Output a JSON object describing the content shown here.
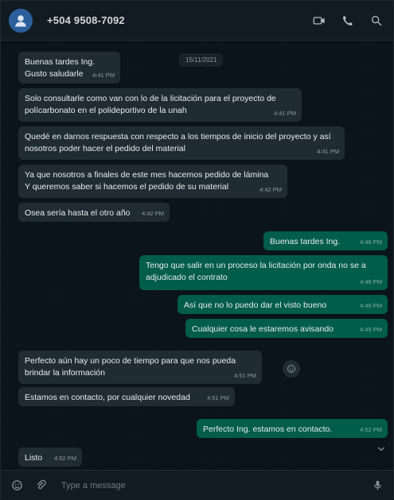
{
  "header": {
    "contact_name": "+504 9508-7092"
  },
  "chat": {
    "date_chip": "15/11/2021",
    "messages": [
      {
        "dir": "in",
        "text": "Buenas tardes Ing.\nGusto saludarle",
        "time": "4:41 PM"
      },
      {
        "dir": "in",
        "text": "Solo consultarle como van con lo de la licitación para el proyecto de polícarbonato en el polideportivo de la unah",
        "time": "4:41 PM"
      },
      {
        "dir": "in",
        "text": "Quedé en darnos respuesta con respecto a los tiempos de inicio del proyecto y así nosotros poder hacer el pedido del material",
        "time": "4:41 PM"
      },
      {
        "dir": "in",
        "text": "Ya que nosotros a finales de este mes hacemos pedido de lámina\nY queremos saber si hacemos el pedido de su material",
        "time": "4:42 PM"
      },
      {
        "dir": "in",
        "text": "Osea sería hasta el otro año",
        "time": "4:42 PM"
      },
      {
        "dir": "out",
        "text": "Buenas tardes Ing.",
        "time": "4:48 PM"
      },
      {
        "dir": "out",
        "text": "Tengo que salir en un proceso la licitación por onda no se a adjudicado el contrato",
        "time": "4:48 PM"
      },
      {
        "dir": "out",
        "text": "Así que no lo puedo dar el visto bueno",
        "time": "4:49 PM"
      },
      {
        "dir": "out",
        "text": "Cualquier cosa le estaremos avisando",
        "time": "4:49 PM"
      },
      {
        "dir": "in",
        "text": "Perfecto aún hay un poco de tiempo para que nos pueda brindar la información",
        "time": "4:51 PM"
      },
      {
        "dir": "in",
        "text": "Estamos en contacto, por cualquier novedad",
        "time": "4:51 PM"
      },
      {
        "dir": "out",
        "text": "Perfecto Ing. estamos en contacto.",
        "time": "4:52 PM"
      },
      {
        "dir": "in",
        "text": "Listo",
        "time": "4:52 PM"
      }
    ]
  },
  "composer": {
    "placeholder": "Type a message"
  },
  "icons": {
    "header": [
      "video-call-icon",
      "voice-call-icon",
      "search-icon"
    ],
    "composer": [
      "emoji-icon",
      "attach-icon",
      "mic-icon"
    ]
  }
}
